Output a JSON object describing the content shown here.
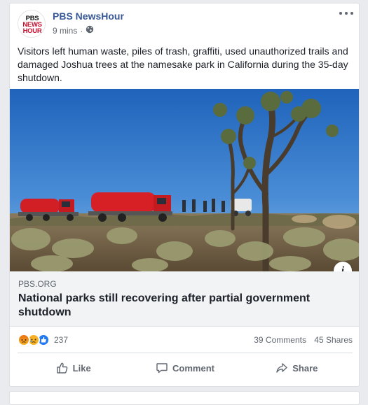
{
  "post": {
    "page_name": "PBS NewsHour",
    "timestamp": "9 mins",
    "separator": "·",
    "privacy_icon": "globe-icon",
    "logo_text": [
      "PBS",
      "NEWS",
      "HOUR"
    ],
    "text": "Visitors left human waste, piles of trash, graffiti, used unauthorized trails and damaged Joshua trees at the namesake park in California during the 35-day shutdown."
  },
  "link_preview": {
    "domain": "PBS.ORG",
    "title": "National parks still recovering after partial government shutdown",
    "info_label": "i"
  },
  "engagement": {
    "reactions": [
      "angry",
      "sad",
      "like"
    ],
    "reaction_count": "237",
    "comments": "39 Comments",
    "shares": "45 Shares"
  },
  "actions": {
    "like": "Like",
    "comment": "Comment",
    "share": "Share"
  },
  "colors": {
    "page_name": "#385898",
    "background": "#e9ebee",
    "link_box": "#f2f3f5",
    "sky": "#2f74c8"
  }
}
